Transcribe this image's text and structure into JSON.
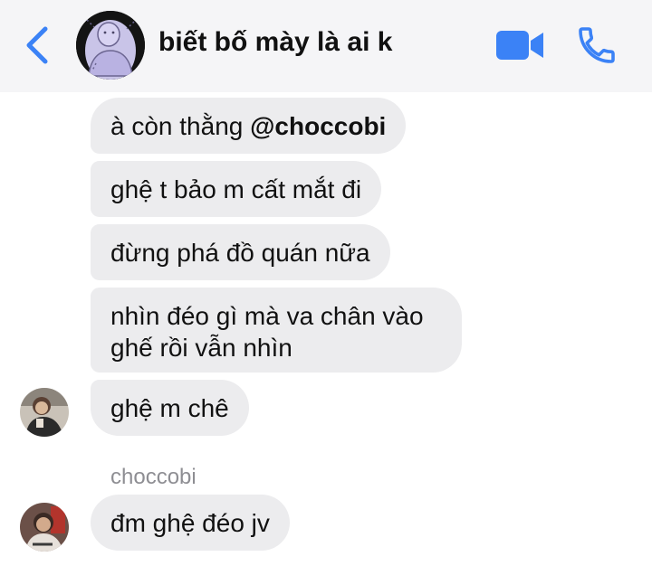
{
  "header": {
    "title": "biết bố mày là ai k",
    "back_icon": "chevron-left-icon",
    "video_icon": "video-camera-icon",
    "call_icon": "phone-icon",
    "accent_color": "#3b82f6"
  },
  "messages": [
    {
      "prefix": "à còn thằng ",
      "mention": "@choccobi"
    },
    {
      "text": "ghệ t bảo m cất mắt đi"
    },
    {
      "text": "đừng phá đồ quán nữa"
    },
    {
      "text": "nhìn đéo gì mà va chân vào ghế rồi vẫn nhìn"
    },
    {
      "text": "ghệ m chê"
    },
    {
      "sender": "choccobi",
      "text": "đm ghệ đéo jv"
    }
  ],
  "colors": {
    "header_bg": "#f5f5f7",
    "bubble_bg": "#ececee",
    "sender_name": "#8e8e93"
  }
}
